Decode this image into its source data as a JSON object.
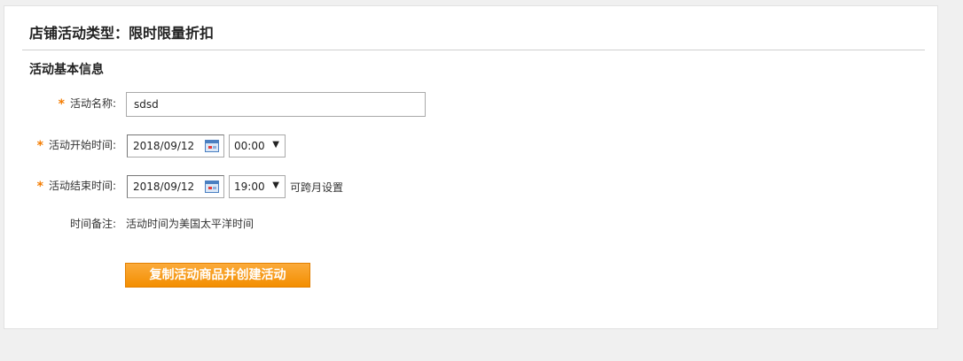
{
  "header": {
    "title": "店铺活动类型：限时限量折扣"
  },
  "section": {
    "title": "活动基本信息"
  },
  "form": {
    "required_mark": "*",
    "name": {
      "label": "活动名称:",
      "value": "sdsd"
    },
    "start": {
      "label": "活动开始时间:",
      "date": "2018/09/12",
      "time": "00:00"
    },
    "end": {
      "label": "活动结束时间:",
      "date": "2018/09/12",
      "time": "19:00",
      "hint": "可跨月设置"
    },
    "note": {
      "label": "时间备注:",
      "value": "活动时间为美国太平洋时间"
    },
    "dropdown_arrow": "▼"
  },
  "actions": {
    "submit_label": "复制活动商品并创建活动"
  },
  "colors": {
    "accent": "#f39200",
    "required": "#f47c00"
  }
}
